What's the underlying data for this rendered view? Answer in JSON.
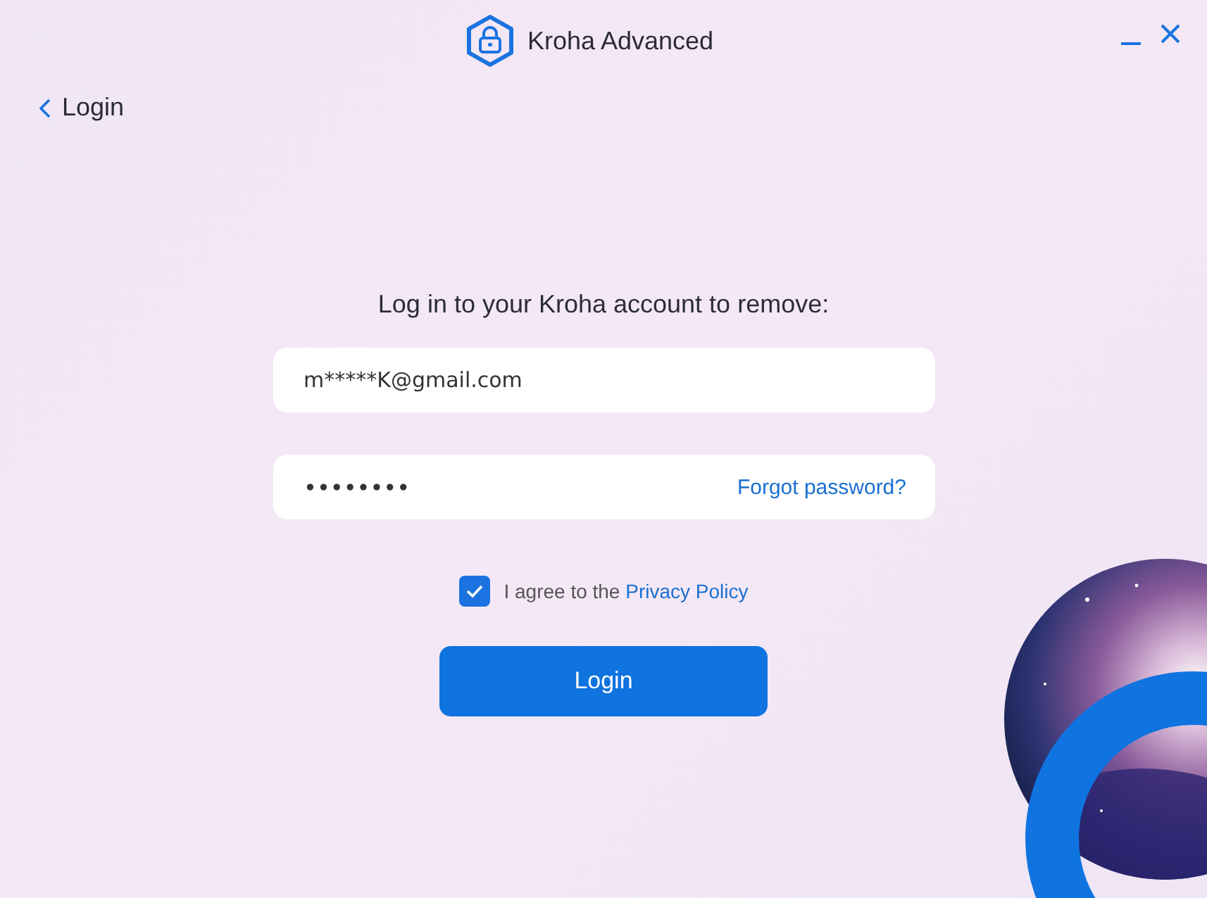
{
  "window": {
    "title": "Kroha Advanced"
  },
  "back": {
    "label": "Login"
  },
  "heading": "Log in to your Kroha account to remove:",
  "email": {
    "value": "m*****K@gmail.com"
  },
  "password": {
    "value": "••••••••",
    "link": "Forgot password?"
  },
  "agreement": {
    "checked": true,
    "text": "I agree to the",
    "link": "Privacy Policy"
  },
  "submit": {
    "label": "Login"
  }
}
